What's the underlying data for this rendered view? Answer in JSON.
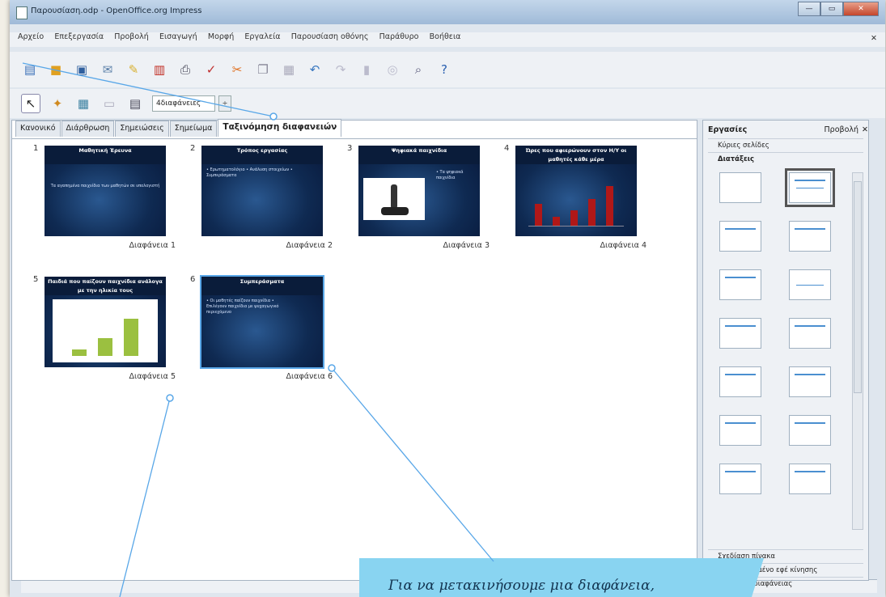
{
  "window": {
    "title": "Παρουσίαση.odp - OpenOffice.org Impress",
    "controls": [
      "—",
      "▭",
      "✕"
    ]
  },
  "menu": [
    "Αρχείο",
    "Επεξεργασία",
    "Προβολή",
    "Εισαγωγή",
    "Μορφή",
    "Εργαλεία",
    "Παρουσίαση οθόνης",
    "Παράθυρο",
    "Βοήθεια"
  ],
  "toolbar": {
    "slides_per_row": "4διαφάνειες",
    "spinner": "÷"
  },
  "tabs": [
    "Κανονικό",
    "Διάρθρωση",
    "Σημειώσεις",
    "Σημείωμα",
    "Ταξινόμηση διαφανειών"
  ],
  "slides": [
    {
      "num": "1",
      "title": "Μαθητική Έρευνα",
      "body": "Τα αγαπημένα παιχνίδια των μαθητών σε υπολογιστή",
      "caption": "Διαφάνεια 1"
    },
    {
      "num": "2",
      "title": "Τρόπος εργασίας",
      "body": "• Ερωτηματολόγιο • Ανάλυση στοιχείων • Συμπεράσματα",
      "caption": "Διαφάνεια 2"
    },
    {
      "num": "3",
      "title": "Ψηφιακά παιχνίδια",
      "body": "• Τα ψηφιακά παιχνίδια",
      "caption": "Διαφάνεια 3"
    },
    {
      "num": "4",
      "title": "Ώρες που αφιερώνουν στον Η/Υ οι μαθητές κάθε μέρα",
      "body": "",
      "caption": "Διαφάνεια 4"
    },
    {
      "num": "5",
      "title": "Παιδιά που παίζουν παιχνίδια ανάλογα με την ηλικία τους",
      "body": "",
      "caption": "Διαφάνεια 5"
    },
    {
      "num": "6",
      "title": "Συμπεράσματα",
      "body": "• Οι μαθητές παίζουν παιχνίδια • Επιλέγουν παιχνίδια με ψυχαγωγικό περιεχόμενο",
      "caption": "Διαφάνεια 6"
    }
  ],
  "taskpane": {
    "title": "Εργασίες",
    "view": "Προβολή",
    "sections_top": [
      "Κύριες σελίδες",
      "Διατάξεις"
    ],
    "sections_bottom": [
      "Σχεδίαση πίνακα",
      "Προσαρμοσμένο εφέ κίνησης",
      "Εναλλαγή διαφάνειας"
    ]
  },
  "callout": {
    "text": "Για να μετακινήσουμε μια διαφάνεια,"
  },
  "colors": {
    "callout": "#89d4f1",
    "selection": "#59a7e8"
  }
}
